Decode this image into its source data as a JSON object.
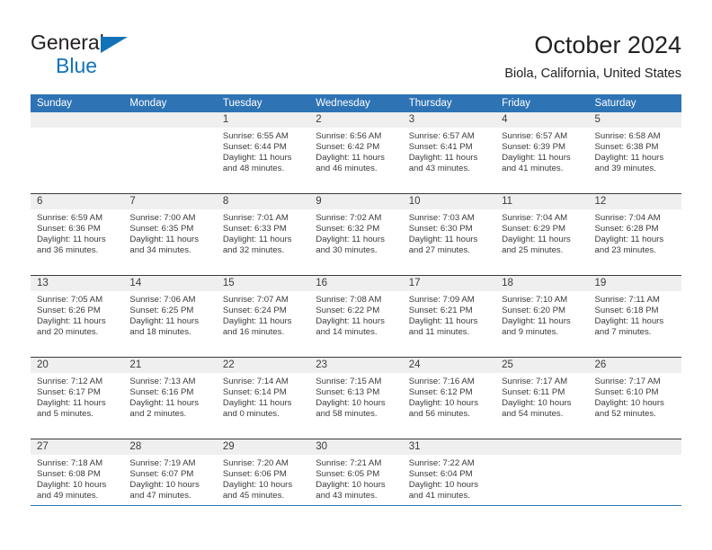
{
  "brand": {
    "line1": "General",
    "line2": "Blue",
    "flag_icon": "triangle-flag-icon",
    "accent_color": "#1272b8"
  },
  "header": {
    "title": "October 2024",
    "subtitle": "Biola, California, United States"
  },
  "theme": {
    "header_blue": "#2e73b4",
    "band_gray": "#efefef",
    "rule_dark": "#3b3b3b",
    "text": "#3b3b3b"
  },
  "calendar": {
    "weekdays": [
      "Sunday",
      "Monday",
      "Tuesday",
      "Wednesday",
      "Thursday",
      "Friday",
      "Saturday"
    ],
    "weeks": [
      [
        {
          "day": "",
          "sunrise": "",
          "sunset": "",
          "daylight1": "",
          "daylight2": ""
        },
        {
          "day": "",
          "sunrise": "",
          "sunset": "",
          "daylight1": "",
          "daylight2": ""
        },
        {
          "day": "1",
          "sunrise": "Sunrise: 6:55 AM",
          "sunset": "Sunset: 6:44 PM",
          "daylight1": "Daylight: 11 hours",
          "daylight2": "and 48 minutes."
        },
        {
          "day": "2",
          "sunrise": "Sunrise: 6:56 AM",
          "sunset": "Sunset: 6:42 PM",
          "daylight1": "Daylight: 11 hours",
          "daylight2": "and 46 minutes."
        },
        {
          "day": "3",
          "sunrise": "Sunrise: 6:57 AM",
          "sunset": "Sunset: 6:41 PM",
          "daylight1": "Daylight: 11 hours",
          "daylight2": "and 43 minutes."
        },
        {
          "day": "4",
          "sunrise": "Sunrise: 6:57 AM",
          "sunset": "Sunset: 6:39 PM",
          "daylight1": "Daylight: 11 hours",
          "daylight2": "and 41 minutes."
        },
        {
          "day": "5",
          "sunrise": "Sunrise: 6:58 AM",
          "sunset": "Sunset: 6:38 PM",
          "daylight1": "Daylight: 11 hours",
          "daylight2": "and 39 minutes."
        }
      ],
      [
        {
          "day": "6",
          "sunrise": "Sunrise: 6:59 AM",
          "sunset": "Sunset: 6:36 PM",
          "daylight1": "Daylight: 11 hours",
          "daylight2": "and 36 minutes."
        },
        {
          "day": "7",
          "sunrise": "Sunrise: 7:00 AM",
          "sunset": "Sunset: 6:35 PM",
          "daylight1": "Daylight: 11 hours",
          "daylight2": "and 34 minutes."
        },
        {
          "day": "8",
          "sunrise": "Sunrise: 7:01 AM",
          "sunset": "Sunset: 6:33 PM",
          "daylight1": "Daylight: 11 hours",
          "daylight2": "and 32 minutes."
        },
        {
          "day": "9",
          "sunrise": "Sunrise: 7:02 AM",
          "sunset": "Sunset: 6:32 PM",
          "daylight1": "Daylight: 11 hours",
          "daylight2": "and 30 minutes."
        },
        {
          "day": "10",
          "sunrise": "Sunrise: 7:03 AM",
          "sunset": "Sunset: 6:30 PM",
          "daylight1": "Daylight: 11 hours",
          "daylight2": "and 27 minutes."
        },
        {
          "day": "11",
          "sunrise": "Sunrise: 7:04 AM",
          "sunset": "Sunset: 6:29 PM",
          "daylight1": "Daylight: 11 hours",
          "daylight2": "and 25 minutes."
        },
        {
          "day": "12",
          "sunrise": "Sunrise: 7:04 AM",
          "sunset": "Sunset: 6:28 PM",
          "daylight1": "Daylight: 11 hours",
          "daylight2": "and 23 minutes."
        }
      ],
      [
        {
          "day": "13",
          "sunrise": "Sunrise: 7:05 AM",
          "sunset": "Sunset: 6:26 PM",
          "daylight1": "Daylight: 11 hours",
          "daylight2": "and 20 minutes."
        },
        {
          "day": "14",
          "sunrise": "Sunrise: 7:06 AM",
          "sunset": "Sunset: 6:25 PM",
          "daylight1": "Daylight: 11 hours",
          "daylight2": "and 18 minutes."
        },
        {
          "day": "15",
          "sunrise": "Sunrise: 7:07 AM",
          "sunset": "Sunset: 6:24 PM",
          "daylight1": "Daylight: 11 hours",
          "daylight2": "and 16 minutes."
        },
        {
          "day": "16",
          "sunrise": "Sunrise: 7:08 AM",
          "sunset": "Sunset: 6:22 PM",
          "daylight1": "Daylight: 11 hours",
          "daylight2": "and 14 minutes."
        },
        {
          "day": "17",
          "sunrise": "Sunrise: 7:09 AM",
          "sunset": "Sunset: 6:21 PM",
          "daylight1": "Daylight: 11 hours",
          "daylight2": "and 11 minutes."
        },
        {
          "day": "18",
          "sunrise": "Sunrise: 7:10 AM",
          "sunset": "Sunset: 6:20 PM",
          "daylight1": "Daylight: 11 hours",
          "daylight2": "and 9 minutes."
        },
        {
          "day": "19",
          "sunrise": "Sunrise: 7:11 AM",
          "sunset": "Sunset: 6:18 PM",
          "daylight1": "Daylight: 11 hours",
          "daylight2": "and 7 minutes."
        }
      ],
      [
        {
          "day": "20",
          "sunrise": "Sunrise: 7:12 AM",
          "sunset": "Sunset: 6:17 PM",
          "daylight1": "Daylight: 11 hours",
          "daylight2": "and 5 minutes."
        },
        {
          "day": "21",
          "sunrise": "Sunrise: 7:13 AM",
          "sunset": "Sunset: 6:16 PM",
          "daylight1": "Daylight: 11 hours",
          "daylight2": "and 2 minutes."
        },
        {
          "day": "22",
          "sunrise": "Sunrise: 7:14 AM",
          "sunset": "Sunset: 6:14 PM",
          "daylight1": "Daylight: 11 hours",
          "daylight2": "and 0 minutes."
        },
        {
          "day": "23",
          "sunrise": "Sunrise: 7:15 AM",
          "sunset": "Sunset: 6:13 PM",
          "daylight1": "Daylight: 10 hours",
          "daylight2": "and 58 minutes."
        },
        {
          "day": "24",
          "sunrise": "Sunrise: 7:16 AM",
          "sunset": "Sunset: 6:12 PM",
          "daylight1": "Daylight: 10 hours",
          "daylight2": "and 56 minutes."
        },
        {
          "day": "25",
          "sunrise": "Sunrise: 7:17 AM",
          "sunset": "Sunset: 6:11 PM",
          "daylight1": "Daylight: 10 hours",
          "daylight2": "and 54 minutes."
        },
        {
          "day": "26",
          "sunrise": "Sunrise: 7:17 AM",
          "sunset": "Sunset: 6:10 PM",
          "daylight1": "Daylight: 10 hours",
          "daylight2": "and 52 minutes."
        }
      ],
      [
        {
          "day": "27",
          "sunrise": "Sunrise: 7:18 AM",
          "sunset": "Sunset: 6:08 PM",
          "daylight1": "Daylight: 10 hours",
          "daylight2": "and 49 minutes."
        },
        {
          "day": "28",
          "sunrise": "Sunrise: 7:19 AM",
          "sunset": "Sunset: 6:07 PM",
          "daylight1": "Daylight: 10 hours",
          "daylight2": "and 47 minutes."
        },
        {
          "day": "29",
          "sunrise": "Sunrise: 7:20 AM",
          "sunset": "Sunset: 6:06 PM",
          "daylight1": "Daylight: 10 hours",
          "daylight2": "and 45 minutes."
        },
        {
          "day": "30",
          "sunrise": "Sunrise: 7:21 AM",
          "sunset": "Sunset: 6:05 PM",
          "daylight1": "Daylight: 10 hours",
          "daylight2": "and 43 minutes."
        },
        {
          "day": "31",
          "sunrise": "Sunrise: 7:22 AM",
          "sunset": "Sunset: 6:04 PM",
          "daylight1": "Daylight: 10 hours",
          "daylight2": "and 41 minutes."
        },
        {
          "day": "",
          "sunrise": "",
          "sunset": "",
          "daylight1": "",
          "daylight2": ""
        },
        {
          "day": "",
          "sunrise": "",
          "sunset": "",
          "daylight1": "",
          "daylight2": ""
        }
      ]
    ]
  }
}
